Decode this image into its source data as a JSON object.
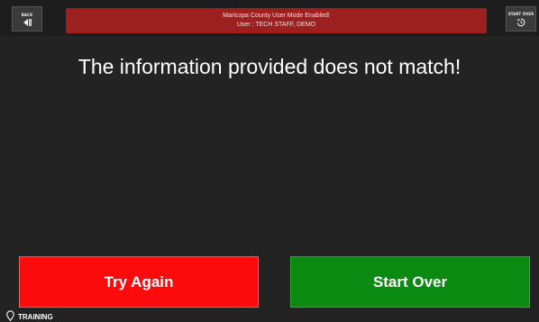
{
  "header": {
    "back_label": "BACK",
    "back_icon": "back-step-icon",
    "start_over_label": "START OVER",
    "start_over_icon": "restart-icon",
    "banner_line1": "Maricopa County User Mode Enabled!",
    "banner_line2": "User : TECH STAFF, DEMO",
    "banner_color": "#9d2020"
  },
  "main": {
    "message": "The information provided does not match!"
  },
  "actions": {
    "try_again_label": "Try Again",
    "try_again_color": "#fb0b0b",
    "start_over_label": "Start Over",
    "start_over_color": "#0b8a12"
  },
  "footer": {
    "mode_label": "TRAINING",
    "mode_icon": "location-pin-icon"
  }
}
